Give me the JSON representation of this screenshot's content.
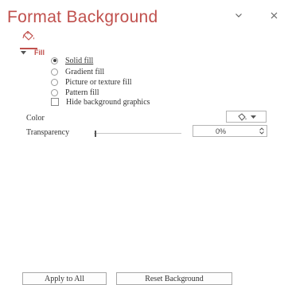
{
  "pane": {
    "title": "Format Background"
  },
  "tabs": [
    {
      "name": "fill-and-line",
      "icon": "paint-bucket-icon",
      "selected": true
    }
  ],
  "section": {
    "label": "Fill",
    "expanded": true
  },
  "fill_options": [
    {
      "label": "Solid fill",
      "selected": true
    },
    {
      "label": "Gradient fill",
      "selected": false
    },
    {
      "label": "Picture or texture fill",
      "selected": false
    },
    {
      "label": "Pattern fill",
      "selected": false
    }
  ],
  "hide_graphics": {
    "label": "Hide background graphics",
    "checked": false
  },
  "color": {
    "label": "Color",
    "icon": "paint-bucket-icon"
  },
  "transparency": {
    "label": "Transparency",
    "value": "0%",
    "level": 0
  },
  "footer": {
    "apply_label": "Apply to All",
    "reset_label": "Reset Background"
  },
  "colors": {
    "accent": "#c0504d",
    "text": "#333333"
  }
}
